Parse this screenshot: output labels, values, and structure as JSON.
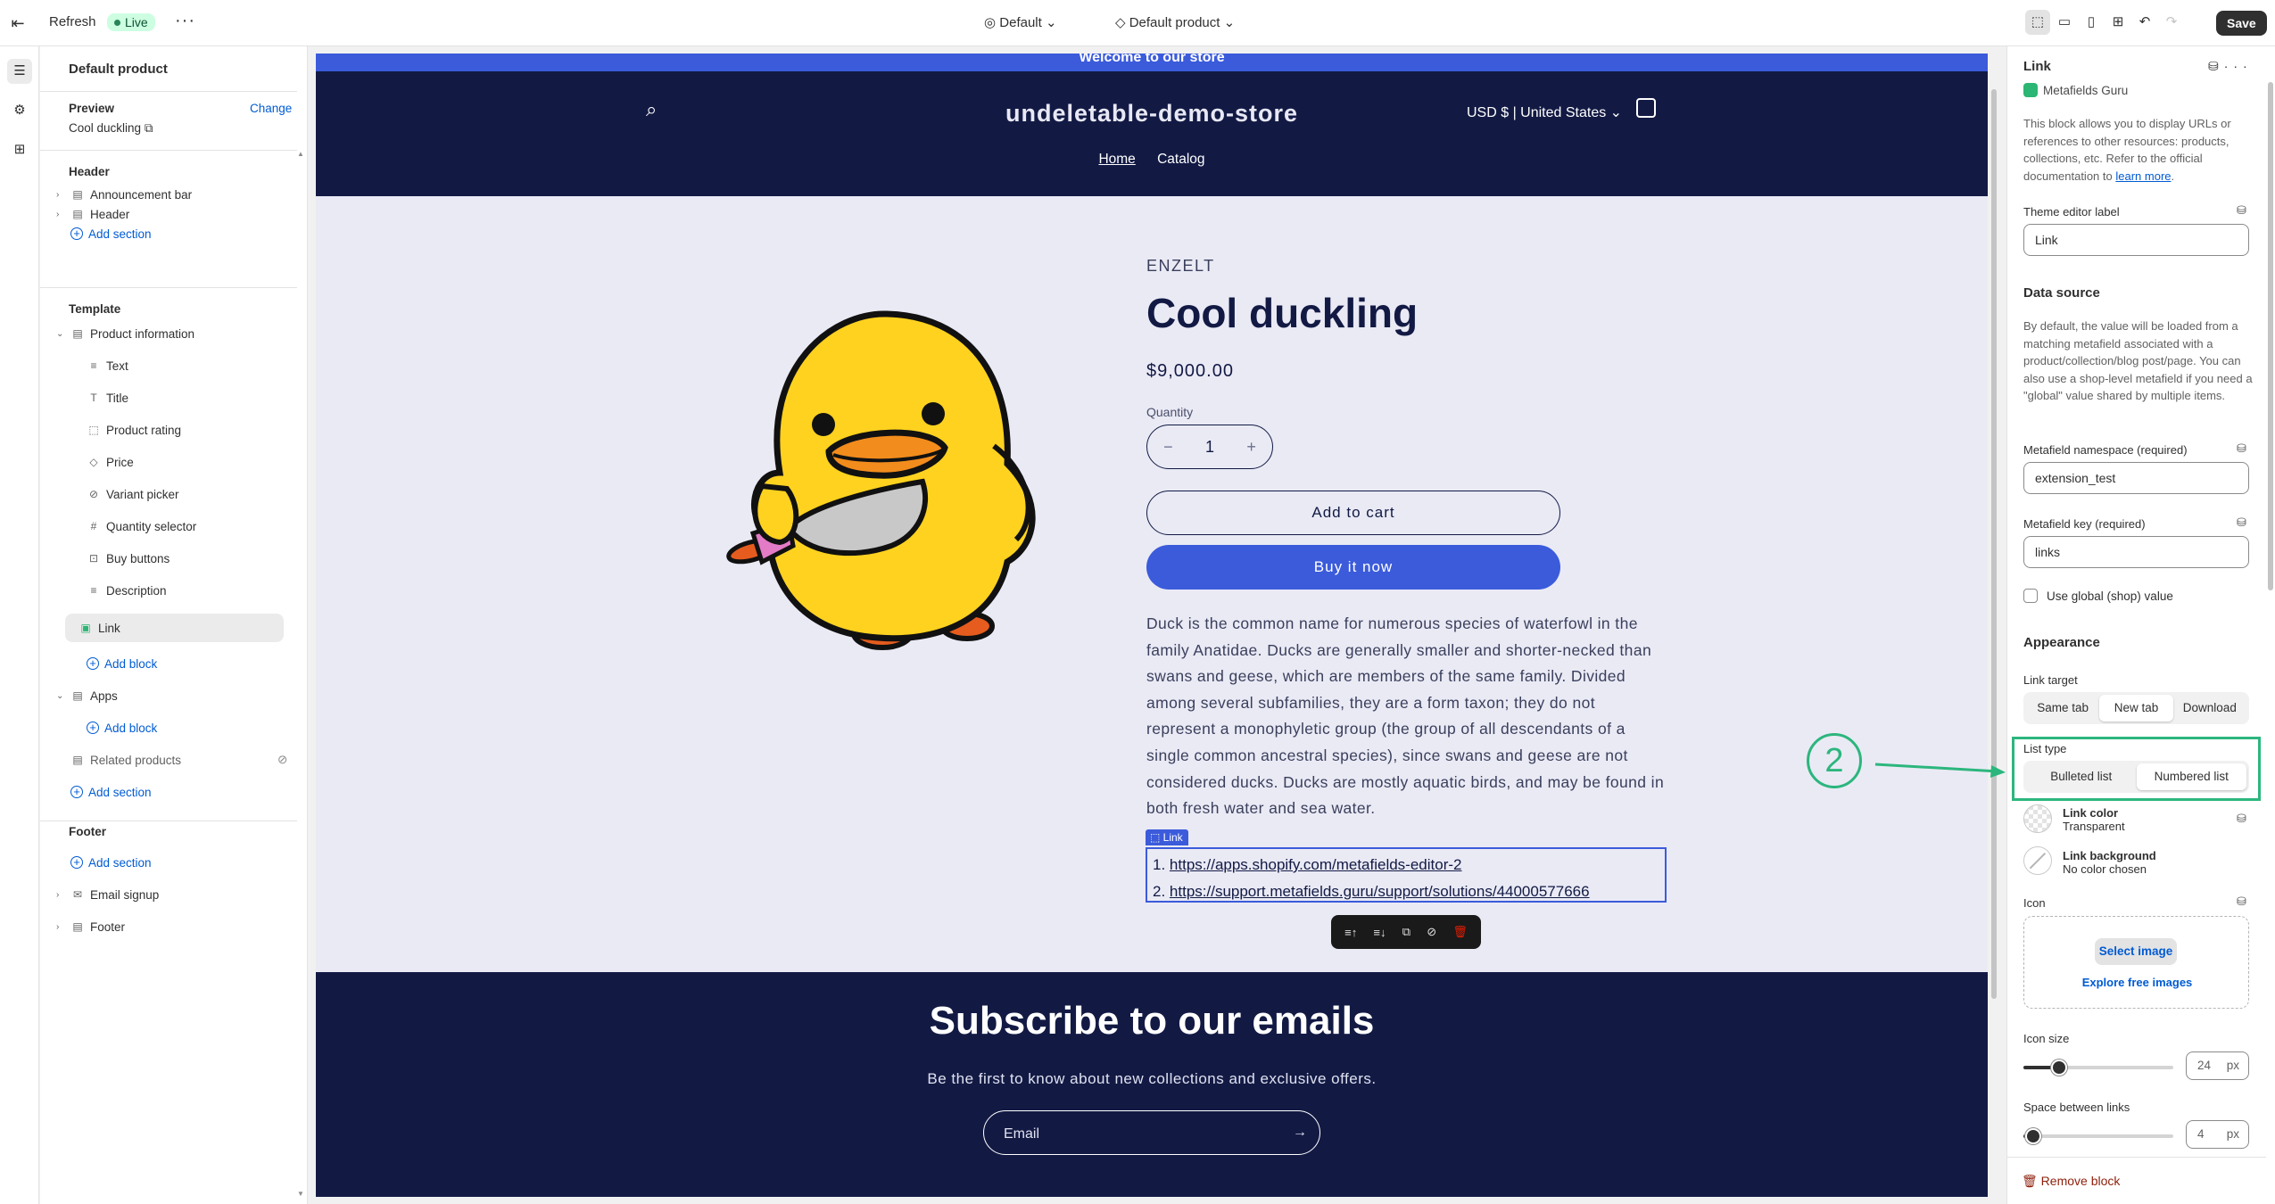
{
  "topbar": {
    "refresh": "Refresh",
    "live": "Live",
    "theme": "Default",
    "template": "Default product",
    "save": "Save"
  },
  "left": {
    "title": "Default product",
    "preview_label": "Preview",
    "change": "Change",
    "preview_product": "Cool duckling",
    "header_heading": "Header",
    "header_items": [
      "Announcement bar",
      "Header"
    ],
    "add_section": "Add section",
    "template_heading": "Template",
    "product_information": "Product information",
    "blocks": [
      "Text",
      "Title",
      "Product rating",
      "Price",
      "Variant picker",
      "Quantity selector",
      "Buy buttons",
      "Description",
      "Link"
    ],
    "add_block": "Add block",
    "apps": "Apps",
    "related_products": "Related products",
    "footer_heading": "Footer",
    "footer_items": [
      "Email signup",
      "Footer"
    ]
  },
  "store": {
    "announcement": "Welcome to our store",
    "logo": "undeletable-demo-store",
    "currency": "USD $ | United States",
    "nav": [
      "Home",
      "Catalog"
    ],
    "vendor": "ENZELT",
    "title": "Cool duckling",
    "price": "$9,000.00",
    "quantity_label": "Quantity",
    "quantity": "1",
    "add_to_cart": "Add to cart",
    "buy_now": "Buy it now",
    "description": "Duck is the common name for numerous species of waterfowl in the family Anatidae. Ducks are generally smaller and shorter-necked than swans and geese, which are members of the same family. Divided among several subfamilies, they are a form taxon; they do not represent a monophyletic group (the group of all descendants of a single common ancestral species), since swans and geese are not considered ducks. Ducks are mostly aquatic birds, and may be found in both fresh water and sea water.",
    "link_tag": "Link",
    "links": [
      "https://apps.shopify.com/metafields-editor-2",
      "https://support.metafields.guru/support/solutions/44000577666"
    ],
    "link_numbers": [
      "1.",
      "2."
    ],
    "subscribe_title": "Subscribe to our emails",
    "subscribe_text": "Be the first to know about new collections and exclusive offers.",
    "email_placeholder": "Email"
  },
  "right": {
    "title": "Link",
    "app_name": "Metafields Guru",
    "intro": "This block allows you to display URLs or references to other resources: products, collections, etc. Refer to the official documentation to",
    "learn_more": "learn more",
    "editor_label": "Theme editor label",
    "editor_value": "Link",
    "data_source": "Data source",
    "data_source_text": "By default, the value will be loaded from a matching metafield associated with a product/collection/blog post/page. You can also use a shop-level metafield if you need a \"global\" value shared by multiple items.",
    "namespace_label": "Metafield namespace (required)",
    "namespace_value": "extension_test",
    "key_label": "Metafield key (required)",
    "key_value": "links",
    "global_label": "Use global (shop) value",
    "appearance": "Appearance",
    "link_target_label": "Link target",
    "link_target_options": [
      "Same tab",
      "New tab",
      "Download"
    ],
    "link_target_selected": "New tab",
    "list_type_label": "List type",
    "list_type_options": [
      "Bulleted list",
      "Numbered list"
    ],
    "list_type_selected": "Numbered list",
    "link_color_label": "Link color",
    "link_color_value": "Transparent",
    "link_bg_label": "Link background",
    "link_bg_value": "No color chosen",
    "icon_label": "Icon",
    "select_image": "Select image",
    "explore_images": "Explore free images",
    "icon_size_label": "Icon size",
    "icon_size": "24",
    "icon_size_max": 100,
    "space_label": "Space between links",
    "space": "4",
    "space_max": 60,
    "px": "px",
    "remove_block": "Remove block"
  },
  "annotation": {
    "number": "2",
    "color": "#2cb67d"
  },
  "colors": {
    "accent": "#3b5bdb",
    "navy": "#121a44",
    "link": "#005bd3"
  }
}
